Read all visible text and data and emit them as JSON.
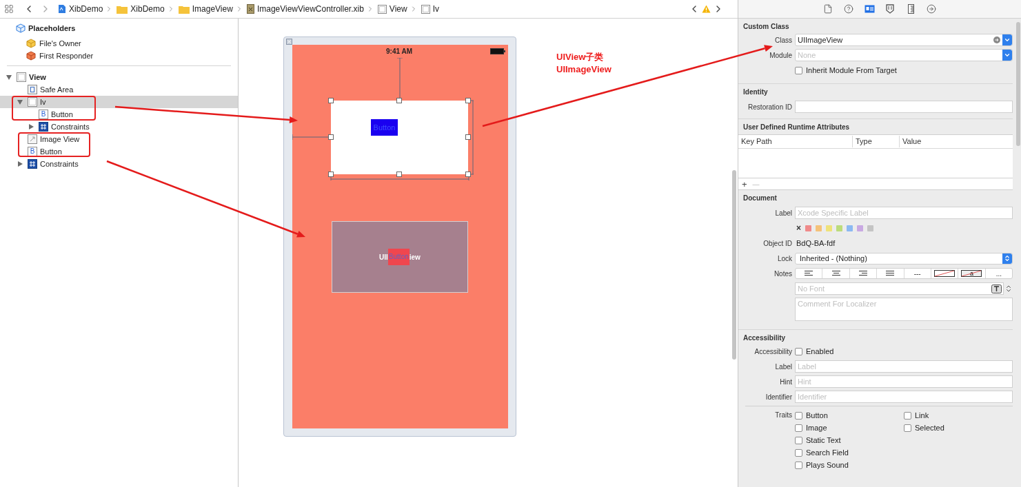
{
  "breadcrumbs": [
    {
      "label": "XibDemo",
      "kind": "project"
    },
    {
      "label": "XibDemo",
      "kind": "folder"
    },
    {
      "label": "ImageView",
      "kind": "folder"
    },
    {
      "label": "ImageViewViewController.xib",
      "kind": "xib"
    },
    {
      "label": "View",
      "kind": "view"
    },
    {
      "label": "Iv",
      "kind": "view"
    }
  ],
  "outline": {
    "placeholders": {
      "label": "Placeholders",
      "items": [
        {
          "label": "File's Owner",
          "kind": "owner"
        },
        {
          "label": "First Responder",
          "kind": "responder"
        }
      ]
    },
    "tree": [
      {
        "label": "View",
        "kind": "view",
        "expanded": true,
        "selected": false,
        "children": [
          {
            "label": "Safe Area",
            "kind": "safe-area",
            "selected": false
          },
          {
            "label": "Iv",
            "kind": "view",
            "expanded": true,
            "selected": true,
            "children": [
              {
                "label": "Button",
                "kind": "button",
                "icon_letter": "B",
                "selected": false
              },
              {
                "label": "Constraints",
                "kind": "constraints",
                "expanded": false,
                "selected": false
              }
            ]
          },
          {
            "label": "Image View",
            "kind": "image-view",
            "selected": false
          },
          {
            "label": "Button",
            "kind": "button",
            "icon_letter": "B",
            "selected": false
          },
          {
            "label": "Constraints",
            "kind": "constraints",
            "expanded": false,
            "selected": false
          }
        ]
      }
    ]
  },
  "canvas": {
    "status_time": "9:41 AM",
    "custom_view": {
      "button": "Button"
    },
    "image_view": {
      "label_left": "UII",
      "button": "Button",
      "label_right": "iew"
    },
    "annotation": [
      "UIView子类",
      "UIImageView"
    ]
  },
  "inspector": {
    "tabs": [
      {
        "kind": "file",
        "selected": false
      },
      {
        "kind": "help",
        "selected": false
      },
      {
        "kind": "identity",
        "selected": true
      },
      {
        "kind": "attributes",
        "selected": false
      },
      {
        "kind": "size",
        "selected": false
      },
      {
        "kind": "connections",
        "selected": false
      }
    ],
    "custom_class": {
      "title": "Custom Class",
      "class_label": "Class",
      "class_value": "UIImageView",
      "module_label": "Module",
      "module_placeholder": "None",
      "inherit": {
        "label": "Inherit Module From Target",
        "checked": false
      }
    },
    "identity": {
      "title": "Identity",
      "restoration_label": "Restoration ID"
    },
    "runtime_attributes": {
      "title": "User Defined Runtime Attributes",
      "columns": [
        "Key Path",
        "Type",
        "Value"
      ],
      "add": "+",
      "remove": "—"
    },
    "document": {
      "title": "Document",
      "label_label": "Label",
      "label_placeholder": "Xcode Specific Label",
      "clear": "×",
      "label_colors": [
        {
          "color": "#f08a8a"
        },
        {
          "color": "#f5c27a"
        },
        {
          "color": "#efe27a"
        },
        {
          "color": "#bcdc7c"
        },
        {
          "color": "#8cb9f2"
        },
        {
          "color": "#c9a9e2"
        },
        {
          "color": "#c4c4c4"
        }
      ],
      "object_id_label": "Object ID",
      "object_id": "BdQ-BA-fdf",
      "lock_label": "Lock",
      "lock_value": "Inherited - (Nothing)",
      "notes_label": "Notes",
      "notes_tools": [
        {
          "kind": "align-left"
        },
        {
          "kind": "align-center"
        },
        {
          "kind": "align-right"
        },
        {
          "kind": "justify"
        },
        {
          "kind": "text",
          "text": "---"
        },
        {
          "kind": "no-color"
        },
        {
          "kind": "no-color-letter",
          "text": "a"
        },
        {
          "kind": "menu",
          "text": "..."
        }
      ],
      "font_placeholder": "No Font",
      "comment_placeholder": "Comment For Localizer"
    },
    "accessibility": {
      "title": "Accessibility",
      "enabled_label": "Accessibility",
      "enabled": {
        "label": "Enabled",
        "checked": false
      },
      "fields": [
        {
          "label": "Label",
          "placeholder": "Label"
        },
        {
          "label": "Hint",
          "placeholder": "Hint"
        },
        {
          "label": "Identifier",
          "placeholder": "Identifier"
        }
      ],
      "traits_label": "Traits",
      "trait_columns": [
        [
          {
            "label": "Button",
            "checked": false
          },
          {
            "label": "Image",
            "checked": false
          },
          {
            "label": "Static Text",
            "checked": false
          },
          {
            "label": "Search Field",
            "checked": false
          },
          {
            "label": "Plays Sound",
            "checked": false
          }
        ],
        [
          {
            "label": "Link",
            "checked": false
          },
          {
            "label": "Selected",
            "checked": false
          }
        ]
      ]
    }
  }
}
